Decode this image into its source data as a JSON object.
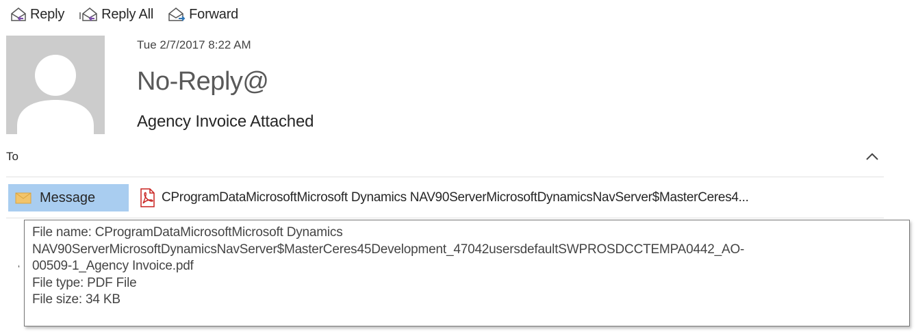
{
  "toolbar": {
    "reply_label": "Reply",
    "reply_all_label": "Reply All",
    "forward_label": "Forward"
  },
  "message": {
    "date": "Tue 2/7/2017 8:22 AM",
    "sender": "No-Reply@",
    "subject": "Agency Invoice Attached",
    "to_label": "To"
  },
  "attachments": {
    "message_tab_label": "Message",
    "file_label": "CProgramDataMicrosoftMicrosoft Dynamics NAV90ServerMicrosoftDynamicsNavServer$MasterCeres4..."
  },
  "tooltip": {
    "line1": "File name:  CProgramDataMicrosoftMicrosoft Dynamics",
    "line2": "NAV90ServerMicrosoftDynamicsNavServer$MasterCeres45Development_47042usersdefaultSWPROSDCCTEMPA0442_AO-",
    "line3": "00509-1_Agency Invoice.pdf",
    "line4": "File type:  PDF File",
    "line5": "File size:  34 KB"
  },
  "colors": {
    "accent_purple": "#7b4fa8",
    "accent_blue": "#2e75b6",
    "selected_tab": "#a9cdf0",
    "avatar_bg": "#cccccc",
    "pdf_red": "#c8201e"
  },
  "icons": {
    "reply": "reply-icon",
    "reply_all": "reply-all-icon",
    "forward": "forward-icon",
    "avatar": "person-silhouette-icon",
    "collapse": "chevron-up-icon",
    "message": "envelope-icon",
    "attachment": "pdf-file-icon"
  }
}
